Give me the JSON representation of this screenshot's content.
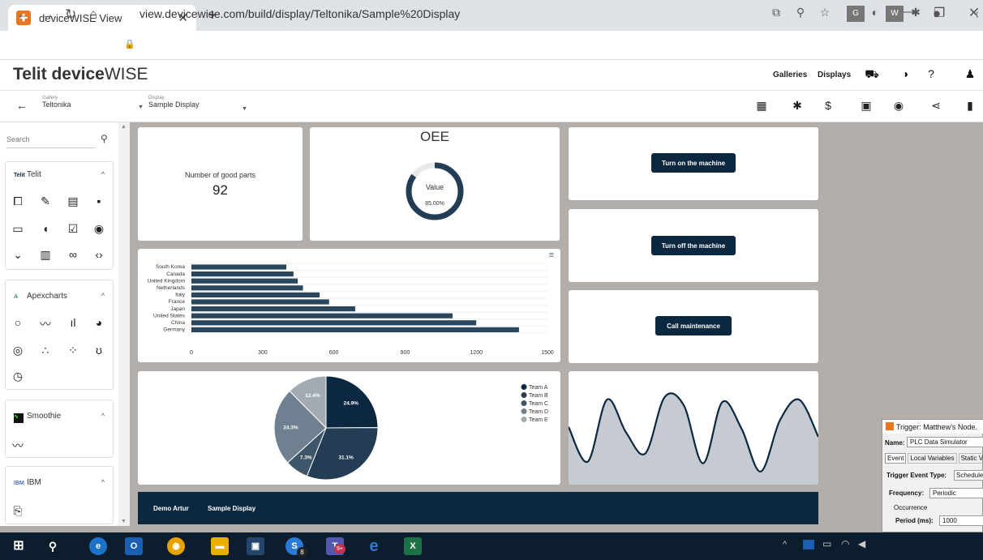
{
  "browser": {
    "tab_title": "deviceWISE View",
    "url": "view.devicewise.com/build/display/Teltonika/Sample%20Display"
  },
  "app": {
    "logo_brand": "Telit",
    "logo_bold": "device",
    "logo_light": "WISE",
    "nav": [
      "Galleries",
      "Displays"
    ]
  },
  "toolbar": {
    "gallery_label": "Gallery",
    "gallery_value": "Teltonika",
    "display_label": "Display",
    "display_value": "Sample Display"
  },
  "sidebar": {
    "search_placeholder": "Search",
    "sections": [
      {
        "title": "Telit",
        "logo": "Telit"
      },
      {
        "title": "Apexcharts",
        "logo": "A"
      },
      {
        "title": "Smoothie",
        "logo": ""
      },
      {
        "title": "IBM",
        "logo": "IBM"
      }
    ]
  },
  "widgets": {
    "good_parts_label": "Number of good parts",
    "good_parts_value": "92",
    "oee_title": "OEE",
    "oee_label": "Value",
    "oee_value": "85.00%",
    "buttons": [
      "Turn on the machine",
      "Turn off the machine",
      "Call maintenance"
    ]
  },
  "footer": {
    "items": [
      "Demo Artur",
      "Sample Display"
    ]
  },
  "trigger": {
    "title": "Trigger:  Matthew's Node.",
    "name_label": "Name:",
    "name_value": "PLC Data Simulator",
    "tabs": [
      "Event",
      "Local Variables",
      "Static Var"
    ],
    "event_type_label": "Trigger Event Type:",
    "event_type_value": "Schedule",
    "frequency_label": "Frequency:",
    "frequency_value": "Periodic",
    "occurrence_label": "Occurrence",
    "period_label": "Period (ms):",
    "period_value": "1000"
  },
  "taskbar": {
    "badges": [
      "8",
      "9+"
    ]
  },
  "colors": {
    "navy": "#0b2840",
    "bar": "#2b475e"
  },
  "chart_data": [
    {
      "type": "bar",
      "orientation": "horizontal",
      "categories": [
        "South Korea",
        "Canada",
        "United Kingdom",
        "Netherlands",
        "Italy",
        "France",
        "Japan",
        "United States",
        "China",
        "Germany"
      ],
      "values": [
        400,
        430,
        448,
        470,
        540,
        580,
        690,
        1100,
        1200,
        1380
      ],
      "xlim": [
        0,
        1500
      ],
      "xticks": [
        "0",
        "300",
        "600",
        "900",
        "1200",
        "1500"
      ],
      "grid": true
    },
    {
      "type": "pie",
      "labels": [
        "Team A",
        "Team B",
        "Team C",
        "Team D",
        "Team E"
      ],
      "values": [
        24.9,
        31.1,
        7.3,
        24.3,
        12.4
      ],
      "value_labels": [
        "24.9%",
        "31.1%",
        "7.3%",
        "24.3%",
        "12.4%"
      ],
      "colors": [
        "#0b2840",
        "#223d54",
        "#3e5669",
        "#6f8090",
        "#a2aab2"
      ],
      "legend": "right"
    },
    {
      "type": "area",
      "values": [
        0.62,
        0.2,
        0.95,
        0.55,
        0.3,
        0.98,
        0.88,
        0.18,
        0.92,
        0.6,
        0.08,
        0.7,
        0.95,
        0.5
      ]
    }
  ]
}
